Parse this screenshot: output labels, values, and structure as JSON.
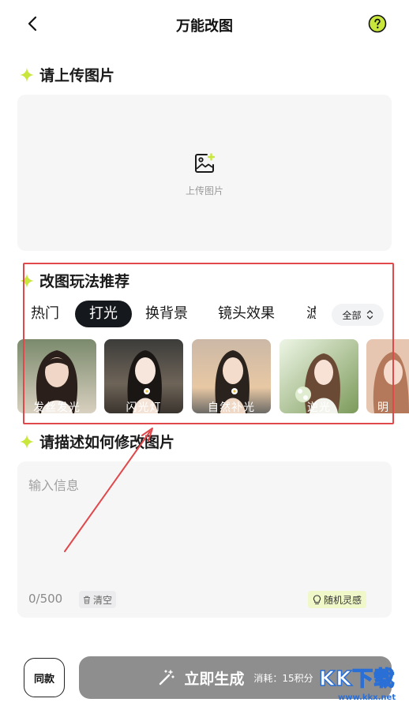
{
  "header": {
    "title": "万能改图",
    "back_icon": "chevron-left-icon",
    "help_icon": "question-circle-icon"
  },
  "upload_section": {
    "title": "请上传图片",
    "upload_label": "上传图片",
    "icon": "image-add-icon"
  },
  "recommend_section": {
    "title": "改图玩法推荐",
    "tabs": [
      {
        "label": "热门",
        "active": false
      },
      {
        "label": "打光",
        "active": true
      },
      {
        "label": "换背景",
        "active": false
      },
      {
        "label": "镜头效果",
        "active": false
      },
      {
        "label": "滤",
        "active": false
      }
    ],
    "all_button": "全部",
    "thumbnails": [
      {
        "label": "发丝发光"
      },
      {
        "label": "闪光灯"
      },
      {
        "label": "自然补光"
      },
      {
        "label": "逆光"
      },
      {
        "label": "明"
      }
    ]
  },
  "describe_section": {
    "title": "请描述如何修改图片",
    "placeholder": "输入信息",
    "counter": "0/500",
    "clear_label": "清空",
    "inspire_label": "随机灵感"
  },
  "bottom": {
    "same_button": "同款",
    "generate_label": "立即生成",
    "cost_label": "消耗：15积分"
  },
  "watermark": {
    "text": "KK下载",
    "url": "www.kkx.net"
  },
  "colors": {
    "accent": "#c8e63c",
    "highlight_border": "#e0484c",
    "active_tab_bg": "#15181c",
    "generate_bg": "#8e8e8e"
  }
}
